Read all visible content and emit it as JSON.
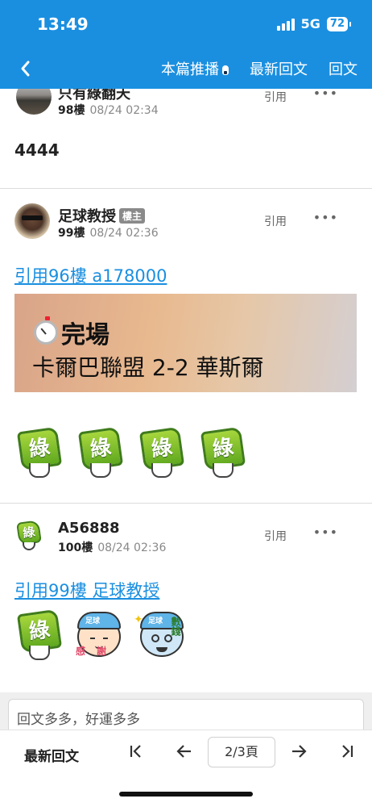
{
  "status_bar": {
    "time": "13:49",
    "network": "5G",
    "battery": "72"
  },
  "nav": {
    "back_icon": "chevron-left-icon",
    "items": [
      "本篇推播",
      "最新回文",
      "回文"
    ]
  },
  "posts": [
    {
      "author": "只有綠翻天",
      "floor": "98樓",
      "date": "08/24 02:34",
      "quote": "引用",
      "more": "•••",
      "body": "4444"
    },
    {
      "author": "足球教授",
      "badge": "樓主",
      "floor": "99樓",
      "date": "08/24 02:36",
      "quote": "引用",
      "more": "•••",
      "quote_link": "引用96樓 a178000",
      "banner": {
        "line1": "完場",
        "line2": "卡爾巴聯盟 2-2 華斯爾"
      },
      "sticker_text": "綠"
    },
    {
      "author": "A56888",
      "floor": "100樓",
      "date": "08/24 02:36",
      "quote": "引用",
      "more": "•••",
      "quote_link": "引用99樓 足球教授",
      "sticker_text": "綠",
      "face_cap": "足球",
      "face1_label": "感謝",
      "face2_label": "數錢"
    }
  ],
  "reply_box": {
    "placeholder": "回文多多，好運多多"
  },
  "bottom": {
    "latest": "最新回文",
    "first": "|<",
    "prev": "←",
    "page": "2/3頁",
    "next": "→",
    "last": ">|"
  }
}
